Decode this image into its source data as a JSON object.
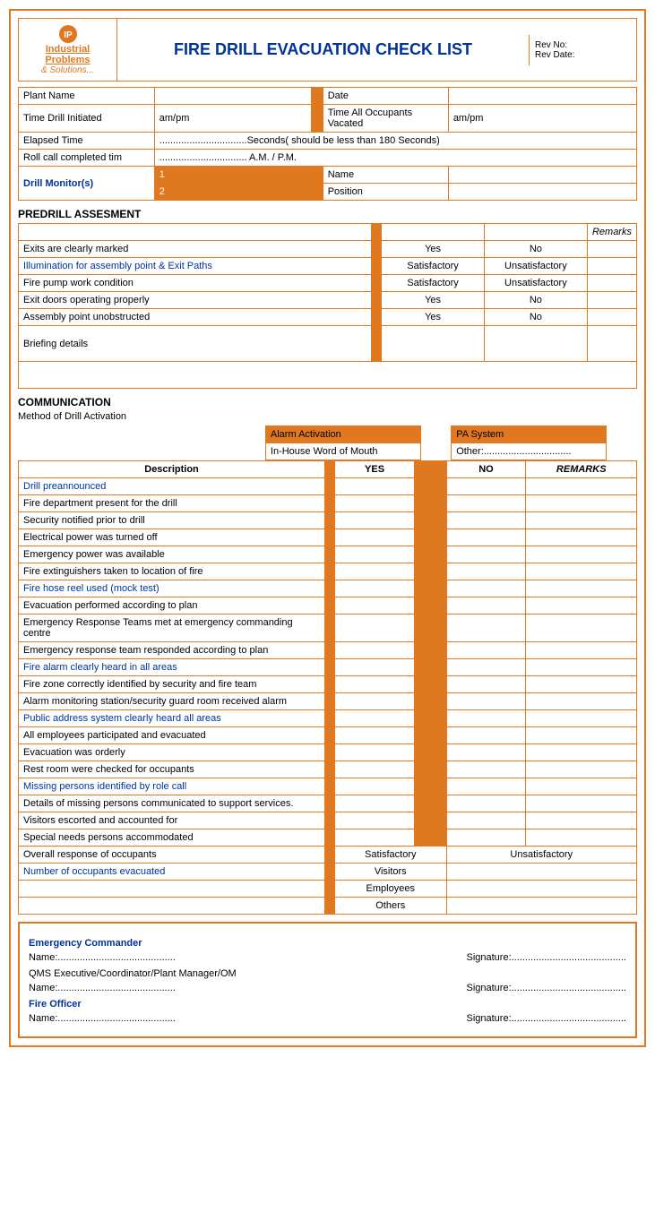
{
  "header": {
    "logo_main": "Industrial Problems",
    "logo_sub": "& Solutions...",
    "title": "FIRE DRILL EVACUATION CHECK LIST",
    "rev_no": "Rev No:",
    "rev_date": "Rev Date:"
  },
  "info": {
    "plant_name_label": "Plant Name",
    "date_label": "Date",
    "time_drill_label": "Time Drill Initiated",
    "ampm1": "am/pm",
    "time_vacated_label": "Time All Occupants Vacated",
    "ampm2": "am/pm",
    "elapsed_label": "Elapsed Time",
    "elapsed_value": "................................Seconds( should be less than 180 Seconds)",
    "rollcall_label": "Roll call completed tim",
    "rollcall_value": "................................ A.M. / P.M.",
    "drill_monitors_label": "Drill Monitor(s)",
    "monitor1_num": "1",
    "monitor1_name": "Name",
    "monitor2_num": "2",
    "monitor2_pos": "Position"
  },
  "predrill": {
    "title": "PREDRILL ASSESMENT",
    "remarks_header": "Remarks",
    "rows": [
      {
        "label": "Exits are clearly marked",
        "blue": false,
        "col1": "Yes",
        "col2": "No"
      },
      {
        "label": "Illumination for assembly point & Exit Paths",
        "blue": true,
        "col1": "Satisfactory",
        "col2": "Unsatisfactory"
      },
      {
        "label": "Fire pump work condition",
        "blue": false,
        "col1": "Satisfactory",
        "col2": "Unsatisfactory"
      },
      {
        "label": "Exit doors operating properly",
        "blue": false,
        "col1": "Yes",
        "col2": "No"
      },
      {
        "label": "Assembly point unobstructed",
        "blue": false,
        "col1": "Yes",
        "col2": "No"
      },
      {
        "label": "Briefing details",
        "blue": false,
        "col1": "",
        "col2": "",
        "tall": true
      }
    ]
  },
  "communication": {
    "title": "COMMUNICATION",
    "method_label": "Method of Drill Activation",
    "method_options": [
      {
        "label": "Alarm Activation"
      },
      {
        "label": "PA System"
      },
      {
        "label": "In-House Word of Mouth"
      },
      {
        "label": "Other:................................"
      }
    ],
    "col_headers": [
      "Description",
      "YES",
      "NO",
      "REMARKS"
    ],
    "rows": [
      {
        "label": "Drill preannounced",
        "blue": true
      },
      {
        "label": "Fire department present for the drill",
        "blue": false
      },
      {
        "label": "Security notified prior to drill",
        "blue": false
      },
      {
        "label": "Electrical power was turned off",
        "blue": false
      },
      {
        "label": "Emergency power was available",
        "blue": false
      },
      {
        "label": "Fire extinguishers taken to location of fire",
        "blue": false
      },
      {
        "label": "Fire hose reel used (mock test)",
        "blue": true
      },
      {
        "label": "Evacuation performed according to plan",
        "blue": false
      },
      {
        "label": "Emergency Response Teams met at emergency commanding centre",
        "blue": false
      },
      {
        "label": "Emergency response team responded according to plan",
        "blue": false
      },
      {
        "label": "Fire alarm clearly heard in all areas",
        "blue": true
      },
      {
        "label": "Fire zone correctly identified by security and fire team",
        "blue": false
      },
      {
        "label": "Alarm monitoring station/security guard room received alarm",
        "blue": false
      },
      {
        "label": "Public address system clearly heard all areas",
        "blue": true
      },
      {
        "label": "All employees participated and evacuated",
        "blue": false
      },
      {
        "label": "Evacuation was orderly",
        "blue": false
      },
      {
        "label": "Rest room were checked for occupants",
        "blue": false
      },
      {
        "label": "Missing persons identified by role call",
        "blue": true
      },
      {
        "label": "Details of missing persons communicated to support services.",
        "blue": false
      },
      {
        "label": "Visitors escorted and accounted for",
        "blue": false
      },
      {
        "label": "Special needs persons accommodated",
        "blue": false
      },
      {
        "label": "Overall response of occupants",
        "blue": false,
        "col1_span": "Satisfactory",
        "col2_span": "Unsatisfactory"
      },
      {
        "label": "Number of occupants evacuated",
        "blue": true,
        "sub": [
          "Visitors",
          "Employees",
          "Others"
        ]
      }
    ]
  },
  "signatures": {
    "roles": [
      {
        "title": "Emergency Commander",
        "name_label": "Name:...........................................",
        "sig_label": "Signature:.........................................."
      },
      {
        "title": "QMS Executive/Coordinator/Plant Manager/OM",
        "name_label": "Name:...........................................",
        "sig_label": "Signature:.........................................."
      },
      {
        "title": "Fire Officer",
        "name_label": "Name:...........................................",
        "sig_label": "Signature:.........................................."
      }
    ]
  }
}
